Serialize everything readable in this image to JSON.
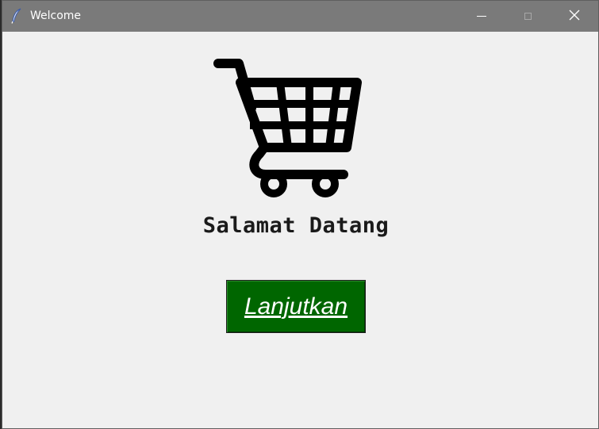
{
  "window": {
    "title": "Welcome",
    "app_icon": "feather-icon",
    "controls": {
      "minimize_icon": "minimize-icon",
      "maximize_icon": "maximize-icon",
      "close_icon": "close-icon"
    }
  },
  "main": {
    "logo_icon": "shopping-cart-icon",
    "welcome_text": "Salamat Datang",
    "continue_button_label": "Lanjutkan"
  },
  "colors": {
    "titlebar": "#7a7a7a",
    "window_bg": "#f0f0f0",
    "button_bg": "#006600",
    "button_text": "#ffffff",
    "text": "#1a1a1a"
  }
}
